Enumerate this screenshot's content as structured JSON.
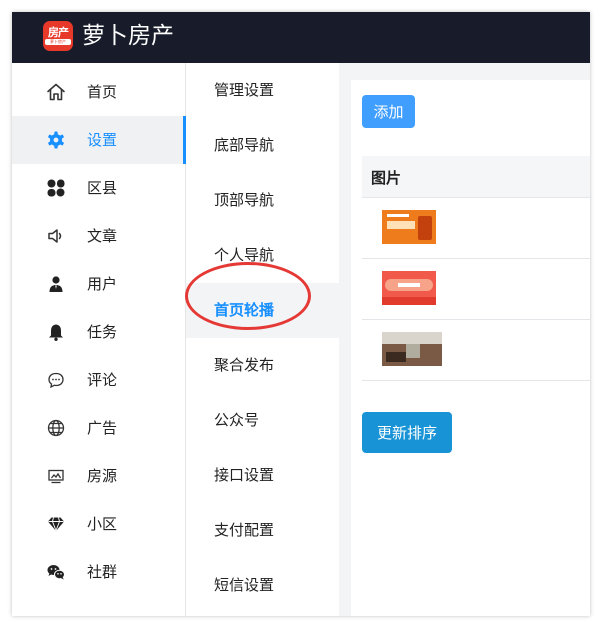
{
  "app": {
    "logo_text": "房产",
    "logo_subtext": "萝卜房产",
    "title": "萝卜房产"
  },
  "sidebar": {
    "items": [
      {
        "label": "首页",
        "icon": "home-icon",
        "active": false
      },
      {
        "label": "设置",
        "icon": "gear-icon",
        "active": true
      },
      {
        "label": "区县",
        "icon": "grid-icon",
        "active": false
      },
      {
        "label": "文章",
        "icon": "speaker-icon",
        "active": false
      },
      {
        "label": "用户",
        "icon": "user-icon",
        "active": false
      },
      {
        "label": "任务",
        "icon": "bell-icon",
        "active": false
      },
      {
        "label": "评论",
        "icon": "chat-bubble-icon",
        "active": false
      },
      {
        "label": "广告",
        "icon": "globe-icon",
        "active": false
      },
      {
        "label": "房源",
        "icon": "monitor-icon",
        "active": false
      },
      {
        "label": "小区",
        "icon": "diamond-icon",
        "active": false
      },
      {
        "label": "社群",
        "icon": "wechat-icon",
        "active": false
      }
    ]
  },
  "subnav": {
    "items": [
      {
        "label": "管理设置",
        "active": false
      },
      {
        "label": "底部导航",
        "active": false
      },
      {
        "label": "顶部导航",
        "active": false
      },
      {
        "label": "个人导航",
        "active": false
      },
      {
        "label": "首页轮播",
        "active": true
      },
      {
        "label": "聚合发布",
        "active": false
      },
      {
        "label": "公众号",
        "active": false
      },
      {
        "label": "接口设置",
        "active": false
      },
      {
        "label": "支付配置",
        "active": false
      },
      {
        "label": "短信设置",
        "active": false
      }
    ]
  },
  "content": {
    "add_button": "添加",
    "table": {
      "column_header": "图片",
      "rows": [
        {
          "thumbnail": "orange-banner-thumbnail"
        },
        {
          "thumbnail": "red-banner-thumbnail"
        },
        {
          "thumbnail": "interior-room-thumbnail"
        }
      ]
    },
    "update_order_button": "更新排序"
  },
  "colors": {
    "header_bg": "#181c2a",
    "accent": "#1890ff",
    "add_button": "#409eff",
    "update_button": "#1894d6",
    "annotation_circle": "#e53935",
    "logo": "#e7392a"
  }
}
